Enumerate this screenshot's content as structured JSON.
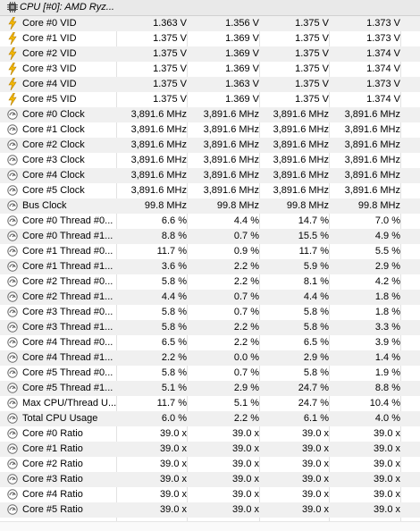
{
  "header": {
    "title": "CPU [#0]: AMD Ryz..."
  },
  "rows": [
    {
      "icon": "voltage-icon",
      "label": "Core #0 VID",
      "values": [
        "1.363 V",
        "1.356 V",
        "1.375 V",
        "1.373 V"
      ]
    },
    {
      "icon": "voltage-icon",
      "label": "Core #1 VID",
      "values": [
        "1.375 V",
        "1.369 V",
        "1.375 V",
        "1.373 V"
      ]
    },
    {
      "icon": "voltage-icon",
      "label": "Core #2 VID",
      "values": [
        "1.375 V",
        "1.369 V",
        "1.375 V",
        "1.374 V"
      ]
    },
    {
      "icon": "voltage-icon",
      "label": "Core #3 VID",
      "values": [
        "1.375 V",
        "1.369 V",
        "1.375 V",
        "1.374 V"
      ]
    },
    {
      "icon": "voltage-icon",
      "label": "Core #4 VID",
      "values": [
        "1.375 V",
        "1.363 V",
        "1.375 V",
        "1.373 V"
      ]
    },
    {
      "icon": "voltage-icon",
      "label": "Core #5 VID",
      "values": [
        "1.375 V",
        "1.369 V",
        "1.375 V",
        "1.374 V"
      ]
    },
    {
      "icon": "gauge-icon",
      "label": "Core #0 Clock",
      "values": [
        "3,891.6 MHz",
        "3,891.6 MHz",
        "3,891.6 MHz",
        "3,891.6 MHz"
      ]
    },
    {
      "icon": "gauge-icon",
      "label": "Core #1 Clock",
      "values": [
        "3,891.6 MHz",
        "3,891.6 MHz",
        "3,891.6 MHz",
        "3,891.6 MHz"
      ]
    },
    {
      "icon": "gauge-icon",
      "label": "Core #2 Clock",
      "values": [
        "3,891.6 MHz",
        "3,891.6 MHz",
        "3,891.6 MHz",
        "3,891.6 MHz"
      ]
    },
    {
      "icon": "gauge-icon",
      "label": "Core #3 Clock",
      "values": [
        "3,891.6 MHz",
        "3,891.6 MHz",
        "3,891.6 MHz",
        "3,891.6 MHz"
      ]
    },
    {
      "icon": "gauge-icon",
      "label": "Core #4 Clock",
      "values": [
        "3,891.6 MHz",
        "3,891.6 MHz",
        "3,891.6 MHz",
        "3,891.6 MHz"
      ]
    },
    {
      "icon": "gauge-icon",
      "label": "Core #5 Clock",
      "values": [
        "3,891.6 MHz",
        "3,891.6 MHz",
        "3,891.6 MHz",
        "3,891.6 MHz"
      ]
    },
    {
      "icon": "gauge-icon",
      "label": "Bus Clock",
      "values": [
        "99.8 MHz",
        "99.8 MHz",
        "99.8 MHz",
        "99.8 MHz"
      ]
    },
    {
      "icon": "gauge-icon",
      "label": "Core #0 Thread #0...",
      "values": [
        "6.6 %",
        "4.4 %",
        "14.7 %",
        "7.0 %"
      ]
    },
    {
      "icon": "gauge-icon",
      "label": "Core #0 Thread #1...",
      "values": [
        "8.8 %",
        "0.7 %",
        "15.5 %",
        "4.9 %"
      ]
    },
    {
      "icon": "gauge-icon",
      "label": "Core #1 Thread #0...",
      "values": [
        "11.7 %",
        "0.9 %",
        "11.7 %",
        "5.5 %"
      ]
    },
    {
      "icon": "gauge-icon",
      "label": "Core #1 Thread #1...",
      "values": [
        "3.6 %",
        "2.2 %",
        "5.9 %",
        "2.9 %"
      ]
    },
    {
      "icon": "gauge-icon",
      "label": "Core #2 Thread #0...",
      "values": [
        "5.8 %",
        "2.2 %",
        "8.1 %",
        "4.2 %"
      ]
    },
    {
      "icon": "gauge-icon",
      "label": "Core #2 Thread #1...",
      "values": [
        "4.4 %",
        "0.7 %",
        "4.4 %",
        "1.8 %"
      ]
    },
    {
      "icon": "gauge-icon",
      "label": "Core #3 Thread #0...",
      "values": [
        "5.8 %",
        "0.7 %",
        "5.8 %",
        "1.8 %"
      ]
    },
    {
      "icon": "gauge-icon",
      "label": "Core #3 Thread #1...",
      "values": [
        "5.8 %",
        "2.2 %",
        "5.8 %",
        "3.3 %"
      ]
    },
    {
      "icon": "gauge-icon",
      "label": "Core #4 Thread #0...",
      "values": [
        "6.5 %",
        "2.2 %",
        "6.5 %",
        "3.9 %"
      ]
    },
    {
      "icon": "gauge-icon",
      "label": "Core #4 Thread #1...",
      "values": [
        "2.2 %",
        "0.0 %",
        "2.9 %",
        "1.4 %"
      ]
    },
    {
      "icon": "gauge-icon",
      "label": "Core #5 Thread #0...",
      "values": [
        "5.8 %",
        "0.7 %",
        "5.8 %",
        "1.9 %"
      ]
    },
    {
      "icon": "gauge-icon",
      "label": "Core #5 Thread #1...",
      "values": [
        "5.1 %",
        "2.9 %",
        "24.7 %",
        "8.8 %"
      ]
    },
    {
      "icon": "gauge-icon",
      "label": "Max CPU/Thread U...",
      "values": [
        "11.7 %",
        "5.1 %",
        "24.7 %",
        "10.4 %"
      ]
    },
    {
      "icon": "gauge-icon",
      "label": "Total CPU Usage",
      "values": [
        "6.0 %",
        "2.2 %",
        "6.1 %",
        "4.0 %"
      ]
    },
    {
      "icon": "gauge-icon",
      "label": "Core #0 Ratio",
      "values": [
        "39.0 x",
        "39.0 x",
        "39.0 x",
        "39.0 x"
      ]
    },
    {
      "icon": "gauge-icon",
      "label": "Core #1 Ratio",
      "values": [
        "39.0 x",
        "39.0 x",
        "39.0 x",
        "39.0 x"
      ]
    },
    {
      "icon": "gauge-icon",
      "label": "Core #2 Ratio",
      "values": [
        "39.0 x",
        "39.0 x",
        "39.0 x",
        "39.0 x"
      ]
    },
    {
      "icon": "gauge-icon",
      "label": "Core #3 Ratio",
      "values": [
        "39.0 x",
        "39.0 x",
        "39.0 x",
        "39.0 x"
      ]
    },
    {
      "icon": "gauge-icon",
      "label": "Core #4 Ratio",
      "values": [
        "39.0 x",
        "39.0 x",
        "39.0 x",
        "39.0 x"
      ]
    },
    {
      "icon": "gauge-icon",
      "label": "Core #5 Ratio",
      "values": [
        "39.0 x",
        "39.0 x",
        "39.0 x",
        "39.0 x"
      ]
    }
  ]
}
